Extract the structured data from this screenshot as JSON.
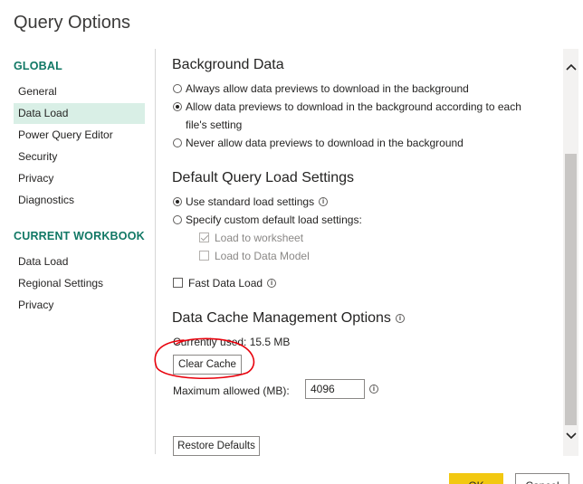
{
  "window": {
    "title": "Query Options"
  },
  "sidebar": {
    "global_header": "GLOBAL",
    "global_items": [
      "General",
      "Data Load",
      "Power Query Editor",
      "Security",
      "Privacy",
      "Diagnostics"
    ],
    "workbook_header": "CURRENT WORKBOOK",
    "workbook_items": [
      "Data Load",
      "Regional Settings",
      "Privacy"
    ],
    "selected": "Data Load"
  },
  "background_data": {
    "heading": "Background Data",
    "options": [
      "Always allow data previews to download in the background",
      "Allow data previews to download in the background according to each",
      "file's setting",
      "Never allow data previews to download in the background"
    ],
    "selected_index": 1
  },
  "default_load": {
    "heading": "Default Query Load Settings",
    "use_standard": "Use standard load settings",
    "specify_custom": "Specify custom default load settings:",
    "load_to_worksheet": "Load to worksheet",
    "load_to_data_model": "Load to Data Model",
    "fast_data_load": "Fast Data Load"
  },
  "cache": {
    "heading": "Data Cache Management Options",
    "currently_used": "Currently used: 15.5 MB",
    "clear_cache_label": "Clear Cache",
    "maximum_label": "Maximum allowed (MB):",
    "maximum_value": "4096"
  },
  "buttons": {
    "restore_defaults": "Restore Defaults",
    "ok": "OK",
    "cancel": "Cancel"
  },
  "icons": {
    "info": "i",
    "scroll_up": "^",
    "scroll_down": "v"
  },
  "colors": {
    "accent_green": "#117865",
    "selected_bg": "#d9efe6",
    "ok_yellow": "#f2c811",
    "annotation_red": "#e8000b"
  }
}
